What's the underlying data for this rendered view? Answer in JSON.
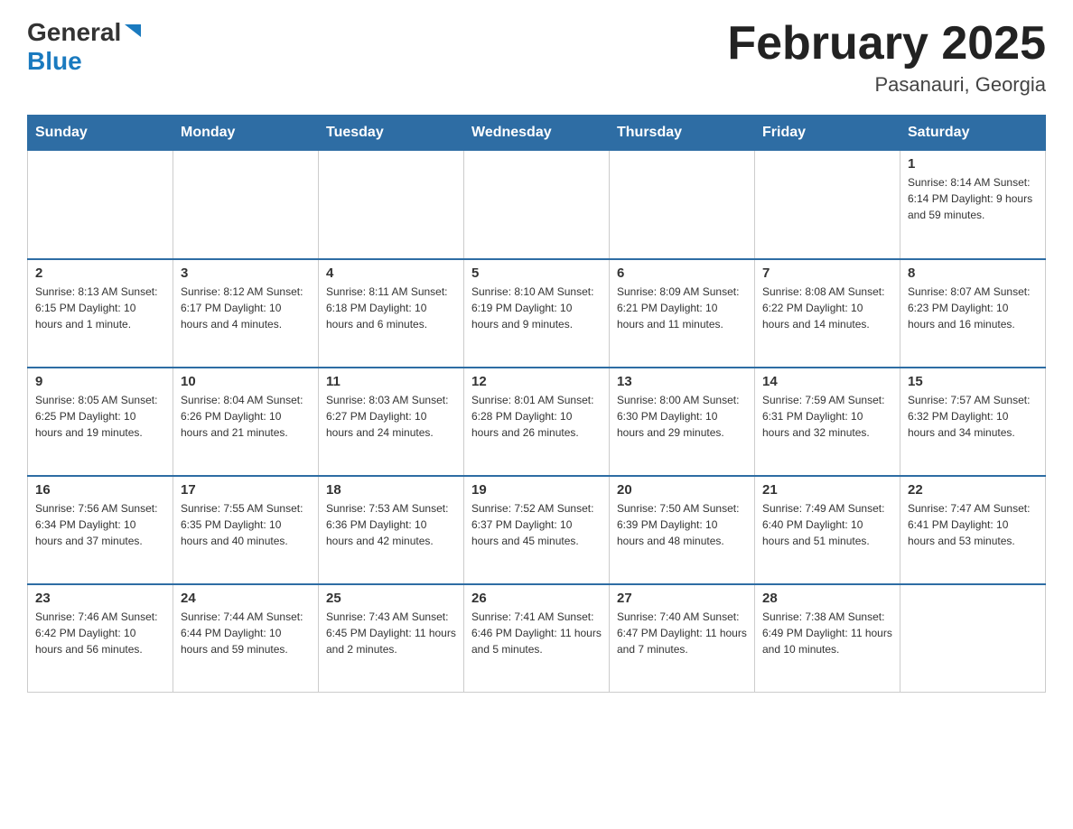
{
  "header": {
    "logo_general": "General",
    "logo_blue": "Blue",
    "title": "February 2025",
    "subtitle": "Pasanauri, Georgia"
  },
  "days_of_week": [
    "Sunday",
    "Monday",
    "Tuesday",
    "Wednesday",
    "Thursday",
    "Friday",
    "Saturday"
  ],
  "weeks": [
    [
      {
        "day": "",
        "info": ""
      },
      {
        "day": "",
        "info": ""
      },
      {
        "day": "",
        "info": ""
      },
      {
        "day": "",
        "info": ""
      },
      {
        "day": "",
        "info": ""
      },
      {
        "day": "",
        "info": ""
      },
      {
        "day": "1",
        "info": "Sunrise: 8:14 AM\nSunset: 6:14 PM\nDaylight: 9 hours and 59 minutes."
      }
    ],
    [
      {
        "day": "2",
        "info": "Sunrise: 8:13 AM\nSunset: 6:15 PM\nDaylight: 10 hours and 1 minute."
      },
      {
        "day": "3",
        "info": "Sunrise: 8:12 AM\nSunset: 6:17 PM\nDaylight: 10 hours and 4 minutes."
      },
      {
        "day": "4",
        "info": "Sunrise: 8:11 AM\nSunset: 6:18 PM\nDaylight: 10 hours and 6 minutes."
      },
      {
        "day": "5",
        "info": "Sunrise: 8:10 AM\nSunset: 6:19 PM\nDaylight: 10 hours and 9 minutes."
      },
      {
        "day": "6",
        "info": "Sunrise: 8:09 AM\nSunset: 6:21 PM\nDaylight: 10 hours and 11 minutes."
      },
      {
        "day": "7",
        "info": "Sunrise: 8:08 AM\nSunset: 6:22 PM\nDaylight: 10 hours and 14 minutes."
      },
      {
        "day": "8",
        "info": "Sunrise: 8:07 AM\nSunset: 6:23 PM\nDaylight: 10 hours and 16 minutes."
      }
    ],
    [
      {
        "day": "9",
        "info": "Sunrise: 8:05 AM\nSunset: 6:25 PM\nDaylight: 10 hours and 19 minutes."
      },
      {
        "day": "10",
        "info": "Sunrise: 8:04 AM\nSunset: 6:26 PM\nDaylight: 10 hours and 21 minutes."
      },
      {
        "day": "11",
        "info": "Sunrise: 8:03 AM\nSunset: 6:27 PM\nDaylight: 10 hours and 24 minutes."
      },
      {
        "day": "12",
        "info": "Sunrise: 8:01 AM\nSunset: 6:28 PM\nDaylight: 10 hours and 26 minutes."
      },
      {
        "day": "13",
        "info": "Sunrise: 8:00 AM\nSunset: 6:30 PM\nDaylight: 10 hours and 29 minutes."
      },
      {
        "day": "14",
        "info": "Sunrise: 7:59 AM\nSunset: 6:31 PM\nDaylight: 10 hours and 32 minutes."
      },
      {
        "day": "15",
        "info": "Sunrise: 7:57 AM\nSunset: 6:32 PM\nDaylight: 10 hours and 34 minutes."
      }
    ],
    [
      {
        "day": "16",
        "info": "Sunrise: 7:56 AM\nSunset: 6:34 PM\nDaylight: 10 hours and 37 minutes."
      },
      {
        "day": "17",
        "info": "Sunrise: 7:55 AM\nSunset: 6:35 PM\nDaylight: 10 hours and 40 minutes."
      },
      {
        "day": "18",
        "info": "Sunrise: 7:53 AM\nSunset: 6:36 PM\nDaylight: 10 hours and 42 minutes."
      },
      {
        "day": "19",
        "info": "Sunrise: 7:52 AM\nSunset: 6:37 PM\nDaylight: 10 hours and 45 minutes."
      },
      {
        "day": "20",
        "info": "Sunrise: 7:50 AM\nSunset: 6:39 PM\nDaylight: 10 hours and 48 minutes."
      },
      {
        "day": "21",
        "info": "Sunrise: 7:49 AM\nSunset: 6:40 PM\nDaylight: 10 hours and 51 minutes."
      },
      {
        "day": "22",
        "info": "Sunrise: 7:47 AM\nSunset: 6:41 PM\nDaylight: 10 hours and 53 minutes."
      }
    ],
    [
      {
        "day": "23",
        "info": "Sunrise: 7:46 AM\nSunset: 6:42 PM\nDaylight: 10 hours and 56 minutes."
      },
      {
        "day": "24",
        "info": "Sunrise: 7:44 AM\nSunset: 6:44 PM\nDaylight: 10 hours and 59 minutes."
      },
      {
        "day": "25",
        "info": "Sunrise: 7:43 AM\nSunset: 6:45 PM\nDaylight: 11 hours and 2 minutes."
      },
      {
        "day": "26",
        "info": "Sunrise: 7:41 AM\nSunset: 6:46 PM\nDaylight: 11 hours and 5 minutes."
      },
      {
        "day": "27",
        "info": "Sunrise: 7:40 AM\nSunset: 6:47 PM\nDaylight: 11 hours and 7 minutes."
      },
      {
        "day": "28",
        "info": "Sunrise: 7:38 AM\nSunset: 6:49 PM\nDaylight: 11 hours and 10 minutes."
      },
      {
        "day": "",
        "info": ""
      }
    ]
  ]
}
